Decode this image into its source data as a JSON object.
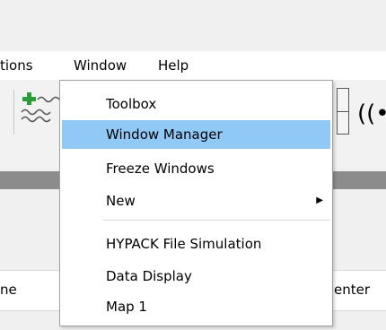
{
  "menubar": {
    "options_label": "tions",
    "window_label": "Window",
    "help_label": "Help"
  },
  "toolbar": {
    "left_tool_icon": "add-wave-icon",
    "right_tool_icon": "broadcast-icon",
    "radio_glyph": "((•"
  },
  "window_menu": {
    "items": [
      {
        "label": "Toolbox"
      },
      {
        "label": "Window Manager",
        "highlighted": true
      },
      {
        "label": "Freeze Windows"
      },
      {
        "label": "New",
        "has_submenu": true
      },
      {
        "label": "HYPACK File Simulation"
      },
      {
        "label": "Data Display"
      },
      {
        "label": "Map 1"
      }
    ],
    "submenu_arrow": "▶"
  },
  "column_headers": {
    "left": "ne",
    "right": "enter"
  },
  "colors": {
    "highlight": "#90c8f6",
    "menu_border": "#a0a0a0",
    "plus_green": "#2a9d3a"
  }
}
